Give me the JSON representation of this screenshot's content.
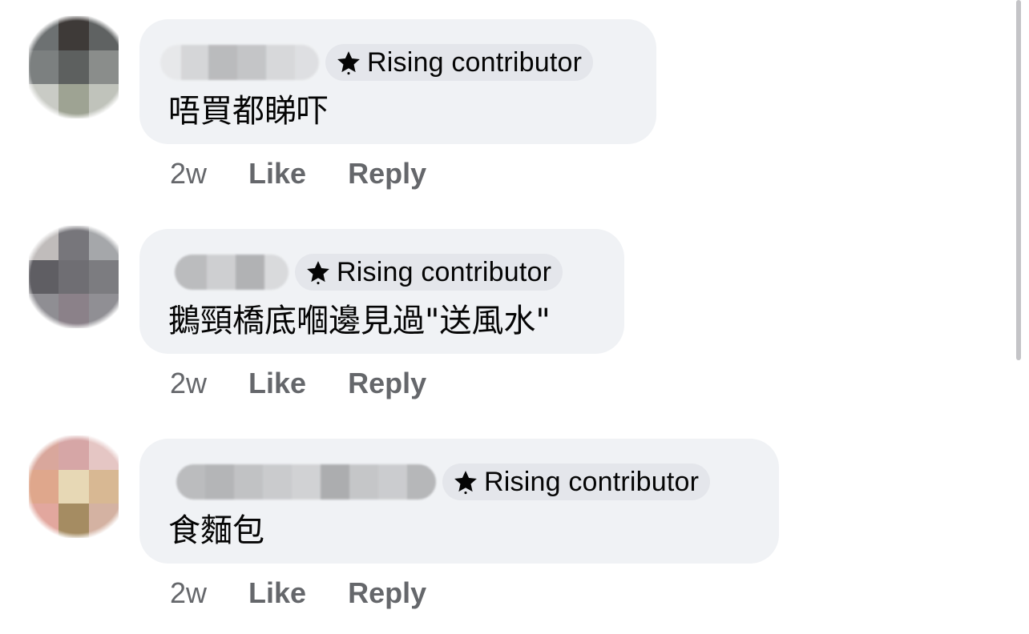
{
  "comments": [
    {
      "badge": "Rising contributor",
      "text": "唔買都睇吓",
      "time": "2w",
      "like": "Like",
      "reply": "Reply"
    },
    {
      "badge": "Rising contributor",
      "text": "鵝頸橋底嗰邊見過\"送風水\"",
      "time": "2w",
      "like": "Like",
      "reply": "Reply"
    },
    {
      "badge": "Rising contributor",
      "text": "食麵包",
      "time": "2w",
      "like": "Like",
      "reply": "Reply"
    }
  ],
  "colors": {
    "bubble": "#f0f2f5",
    "badge": "#e4e6eb",
    "secondary_text": "#65676b",
    "primary_text": "#050505"
  },
  "icons": {
    "badge_icon": "star-icon"
  }
}
